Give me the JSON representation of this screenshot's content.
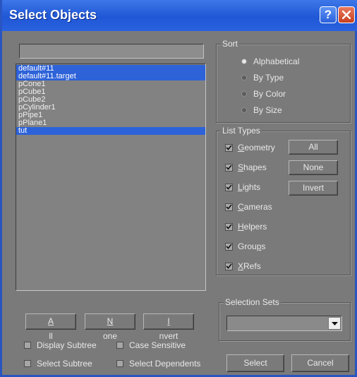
{
  "window": {
    "title": "Select Objects",
    "help_glyph": "?"
  },
  "name_field": {
    "value": ""
  },
  "objects": {
    "items": [
      {
        "label": "default#11",
        "selected": true
      },
      {
        "label": "default#11.target",
        "selected": true
      },
      {
        "label": "pCone1",
        "selected": false
      },
      {
        "label": "pCube1",
        "selected": false
      },
      {
        "label": "pCube2",
        "selected": false
      },
      {
        "label": "pCylinder1",
        "selected": false
      },
      {
        "label": "pPipe1",
        "selected": false
      },
      {
        "label": "pPlane1",
        "selected": false
      },
      {
        "label": "tut",
        "selected": true
      }
    ]
  },
  "sort": {
    "label": "Sort",
    "options": [
      "Alphabetical",
      "By Type",
      "By Color",
      "By Size"
    ],
    "selected": "Alphabetical"
  },
  "list_types": {
    "label": "List Types",
    "items": [
      {
        "pre": "",
        "key": "G",
        "post": "eometry",
        "checked": true
      },
      {
        "pre": "",
        "key": "S",
        "post": "hapes",
        "checked": true
      },
      {
        "pre": "",
        "key": "L",
        "post": "ights",
        "checked": true
      },
      {
        "pre": "",
        "key": "C",
        "post": "ameras",
        "checked": true
      },
      {
        "pre": "",
        "key": "H",
        "post": "elpers",
        "checked": true
      },
      {
        "pre": "Grou",
        "key": "p",
        "post": "s",
        "checked": true
      },
      {
        "pre": "",
        "key": "X",
        "post": "Refs",
        "checked": true
      }
    ],
    "all_label": "All",
    "none_label": "None",
    "invert_label": "Invert"
  },
  "list_buttons": {
    "all": {
      "key": "A",
      "rest": "ll"
    },
    "none": {
      "key": "N",
      "rest": "one"
    },
    "invert": {
      "key": "I",
      "rest": "nvert"
    }
  },
  "selection_sets": {
    "label": "Selection Sets",
    "value": ""
  },
  "options": {
    "display_subtree": "Display Subtree",
    "case_sensitive": "Case Sensitive",
    "select_subtree": "Select Subtree",
    "select_dependents": "Select Dependents"
  },
  "actions": {
    "select": "Select",
    "cancel": "Cancel"
  }
}
